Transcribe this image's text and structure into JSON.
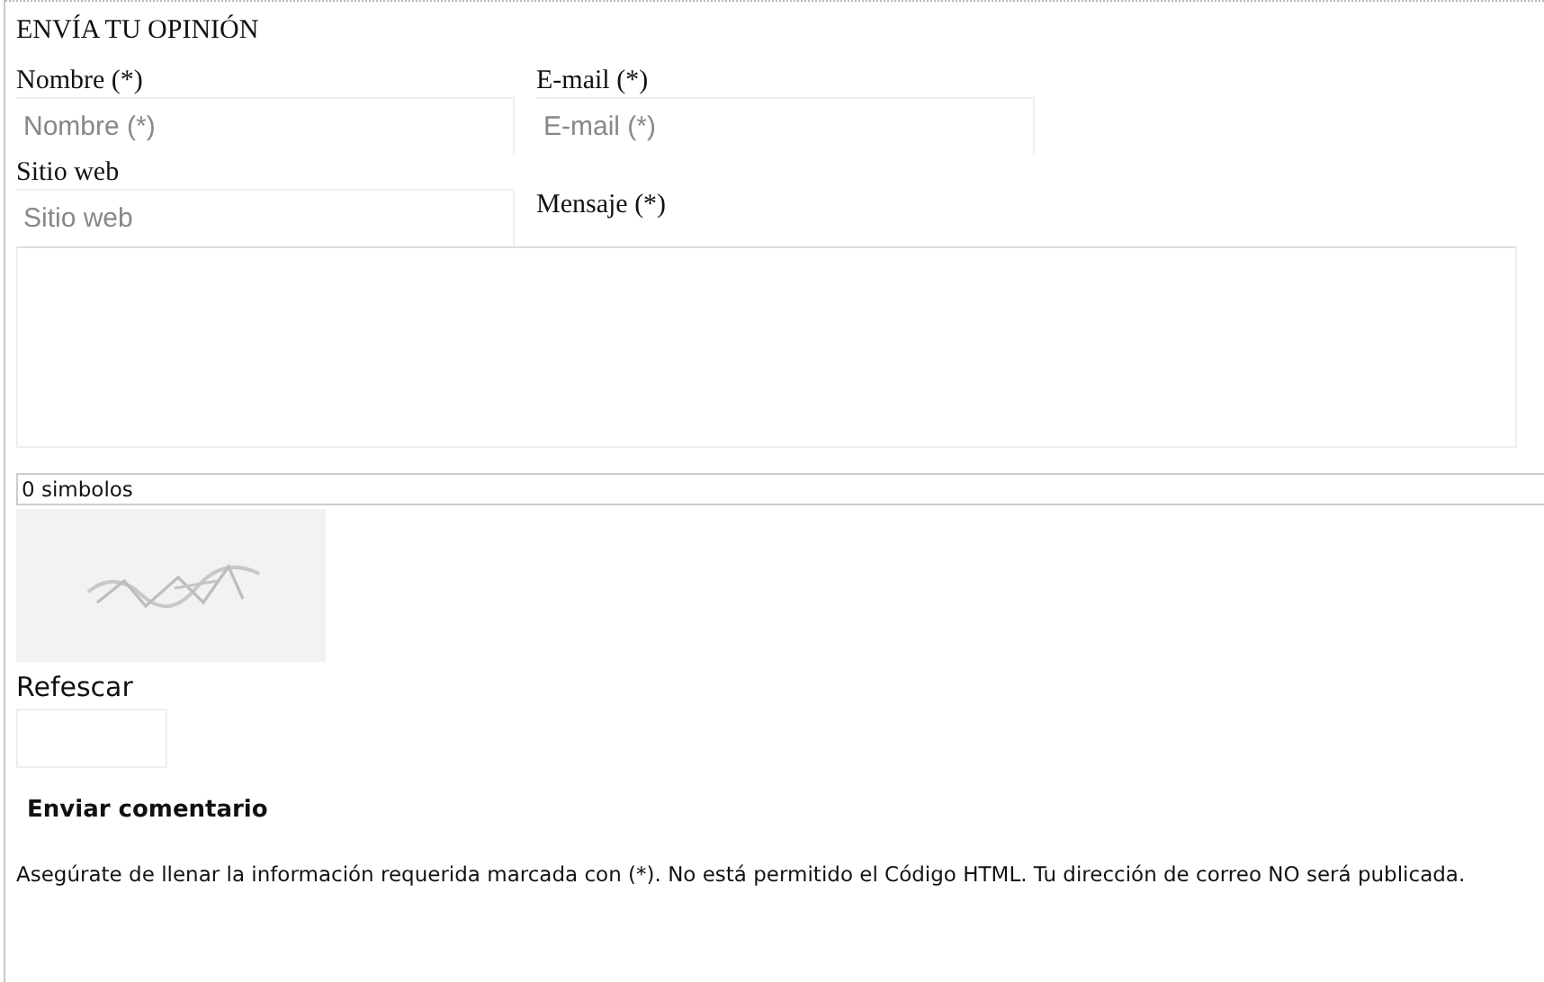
{
  "title": "ENVÍA TU OPINIÓN",
  "fields": [
    {
      "label": "Nombre (*)",
      "placeholder": "Nombre (*)"
    },
    {
      "label": "E-mail (*)",
      "placeholder": "E-mail (*)"
    },
    {
      "label": "Sitio web",
      "placeholder": "Sitio web"
    }
  ],
  "message": {
    "label": "Mensaje (*)"
  },
  "counter": "0 simbolos",
  "captcha": {
    "kind": "picture",
    "refresh": "Refescar"
  },
  "submit": "Enviar comentario",
  "note": "Asegúrate de llenar la información requerida marcada con (*). No está permitido el Código HTML. Tu dirección de correo NO será publicada."
}
